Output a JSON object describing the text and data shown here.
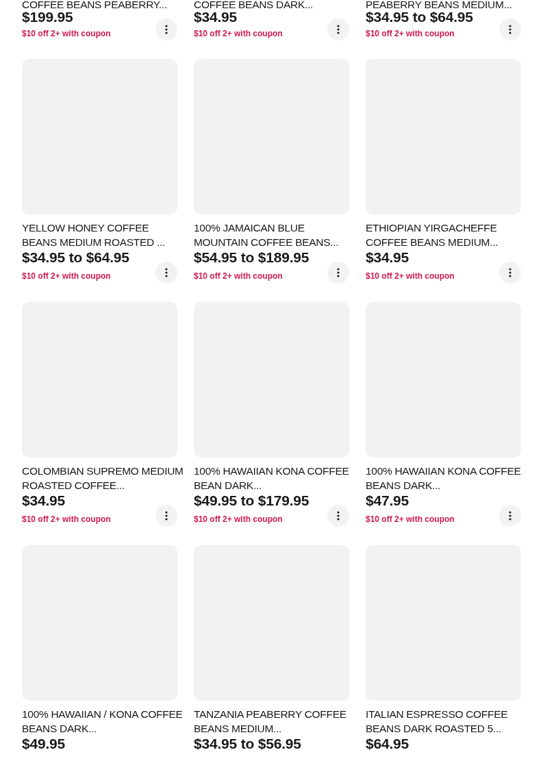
{
  "products": [
    {
      "kind": "cut",
      "title": "COFFEE BEANS PEABERRY...",
      "price": "$199.95",
      "coupon": "$10 off 2+ with coupon"
    },
    {
      "kind": "cut",
      "title": "COFFEE BEANS DARK...",
      "price": "$34.95",
      "coupon": "$10 off 2+ with coupon"
    },
    {
      "kind": "cut",
      "title": "PEABERRY BEANS MEDIUM...",
      "price": "$34.95 to $64.95",
      "coupon": "$10 off 2+ with coupon"
    },
    {
      "kind": "full",
      "title": "YELLOW HONEY COFFEE BEANS MEDIUM ROASTED ...",
      "price": "$34.95 to $64.95",
      "coupon": "$10 off 2+ with coupon"
    },
    {
      "kind": "full",
      "title": "100% JAMAICAN BLUE MOUNTAIN COFFEE BEANS...",
      "price": "$54.95 to $189.95",
      "coupon": "$10 off 2+ with coupon"
    },
    {
      "kind": "full",
      "title": "ETHIOPIAN YIRGACHEFFE COFFEE BEANS MEDIUM...",
      "price": "$34.95",
      "coupon": "$10 off 2+ with coupon"
    },
    {
      "kind": "full",
      "title": "COLOMBIAN SUPREMO MEDIUM ROASTED COFFEE...",
      "price": "$34.95",
      "coupon": "$10 off 2+ with coupon"
    },
    {
      "kind": "full",
      "title": "100% HAWAIIAN KONA COFFEE BEAN DARK...",
      "price": "$49.95 to $179.95",
      "coupon": "$10 off 2+ with coupon"
    },
    {
      "kind": "full",
      "title": "100% HAWAIIAN KONA COFFEE BEANS DARK...",
      "price": "$47.95",
      "coupon": "$10 off 2+ with coupon"
    },
    {
      "kind": "full",
      "title": "100% HAWAIIAN / KONA COFFEE BEANS DARK...",
      "price": "$49.95"
    },
    {
      "kind": "full",
      "title": "TANZANIA PEABERRY COFFEE BEANS MEDIUM...",
      "price": "$34.95 to $56.95"
    },
    {
      "kind": "full",
      "title": "ITALIAN ESPRESSO COFFEE BEANS DARK ROASTED 5...",
      "price": "$64.95"
    }
  ]
}
